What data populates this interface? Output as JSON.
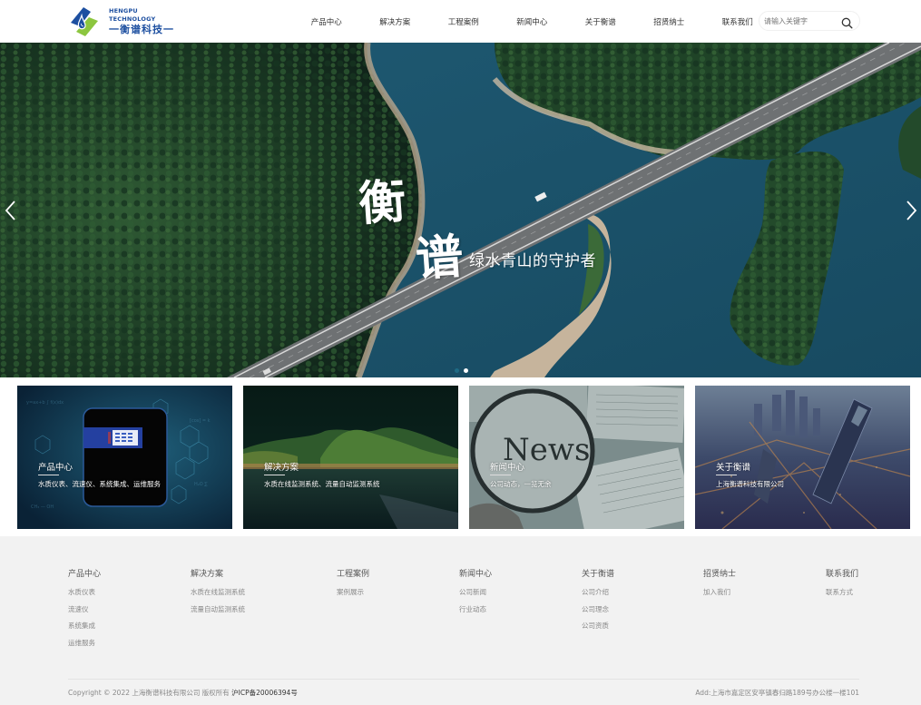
{
  "header": {
    "logo": {
      "en": "HENGPU TECHNOLOGY",
      "cn": "一衡谱科技一",
      "colors": {
        "blue": "#1d4fa0",
        "green": "#8cc63f"
      }
    },
    "nav": [
      {
        "label": "产品中心"
      },
      {
        "label": "解决方案"
      },
      {
        "label": "工程案例"
      },
      {
        "label": "新闻中心"
      },
      {
        "label": "关于衡谱"
      },
      {
        "label": "招贤纳士"
      },
      {
        "label": "联系我们"
      }
    ],
    "search": {
      "placeholder": "请输入关键字",
      "value": "",
      "icon": "search-icon"
    }
  },
  "hero": {
    "title_char_1": "衡",
    "title_char_2": "谱",
    "slogan": "绿水青山的守护者",
    "prev_icon": "chevron-left-icon",
    "next_icon": "chevron-right-icon",
    "slides_total": 2,
    "active_slide": 2,
    "colors": {
      "dot_active": "#ffffff",
      "dot_inactive": "#1f6b85"
    }
  },
  "cards": [
    {
      "title": "产品中心",
      "desc": "水质仪表、流速仪、系统集成、运维服务"
    },
    {
      "title": "解决方案",
      "desc": "水质在线监测系统、流量自动监测系统"
    },
    {
      "title": "新闻中心",
      "desc": "公司动态，一览无余",
      "image_text": "News"
    },
    {
      "title": "关于衡谱",
      "desc": "上海衡谱科技有限公司"
    }
  ],
  "footer": {
    "columns": [
      {
        "title": "产品中心",
        "links": [
          "水质仪表",
          "流速仪",
          "系统集成",
          "运维服务"
        ]
      },
      {
        "title": "解决方案",
        "links": [
          "水质在线监测系统",
          "流量自动监测系统"
        ]
      },
      {
        "title": "工程案例",
        "links": [
          "案例展示"
        ]
      },
      {
        "title": "新闻中心",
        "links": [
          "公司新闻",
          "行业动态"
        ]
      },
      {
        "title": "关于衡谱",
        "links": [
          "公司介绍",
          "公司理念",
          "公司资质"
        ]
      },
      {
        "title": "招贤纳士",
        "links": [
          "加入我们"
        ]
      },
      {
        "title": "联系我们",
        "links": [
          "联系方式"
        ]
      }
    ],
    "copyright": "Copyright © 2022 上海衡谱科技有限公司 版权所有",
    "icp": "沪ICP备20006394号",
    "address": "Add:上海市嘉定区安亭镇春归路189号办公楼一楼101"
  }
}
